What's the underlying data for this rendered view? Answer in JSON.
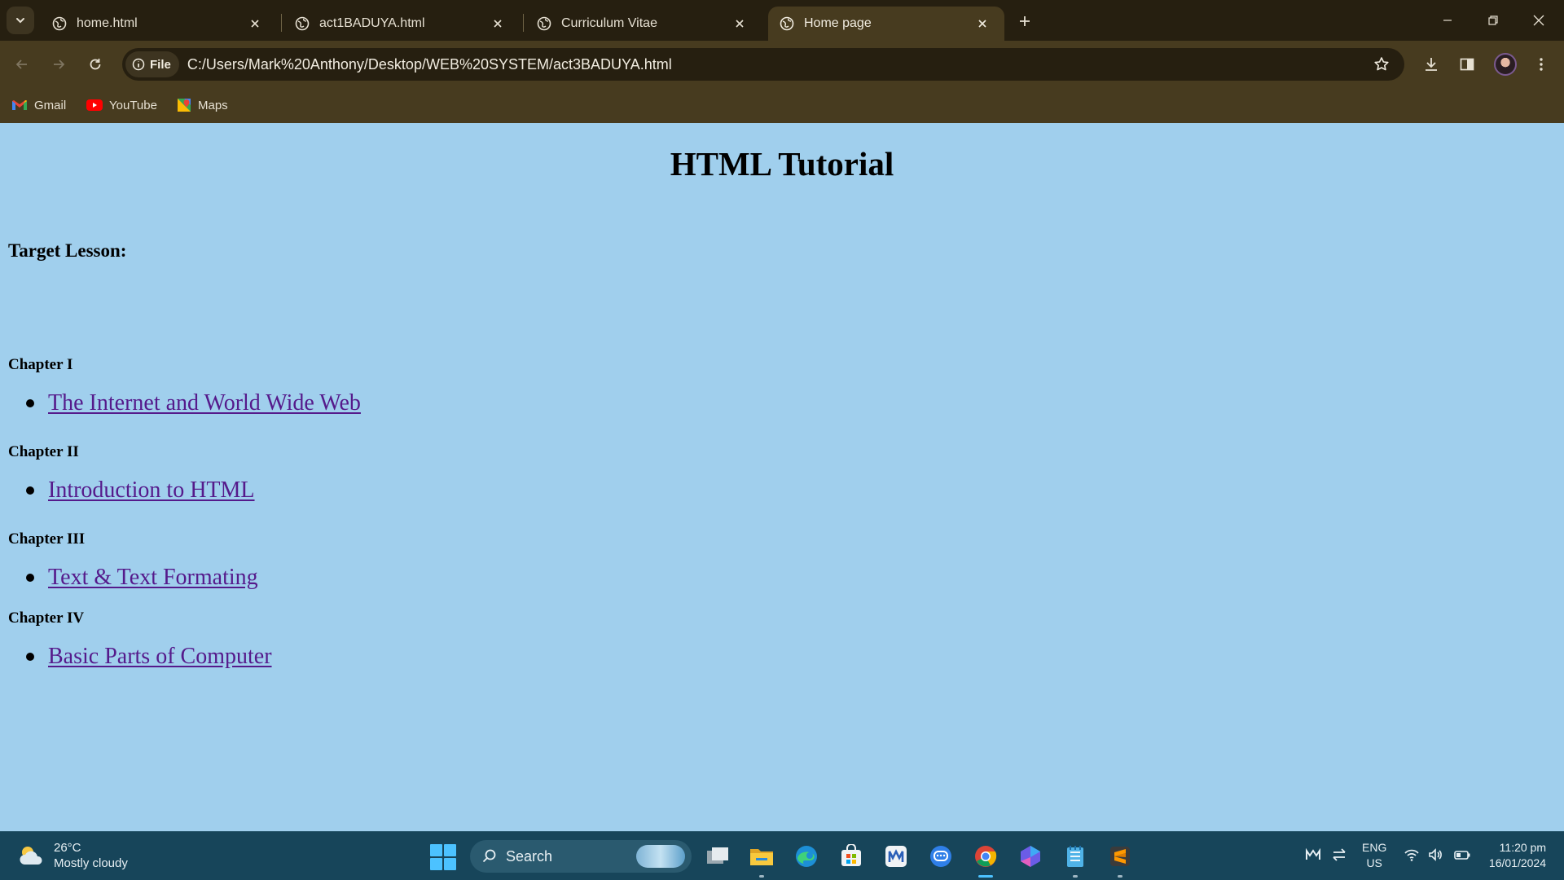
{
  "browser": {
    "tabs": [
      {
        "title": "home.html"
      },
      {
        "title": "act1BADUYA.html"
      },
      {
        "title": "Curriculum Vitae"
      },
      {
        "title": "Home page"
      }
    ],
    "active_tab": 3,
    "omnibox": {
      "chip_label": "File",
      "url": "C:/Users/Mark%20Anthony/Desktop/WEB%20SYSTEM/act3BADUYA.html"
    },
    "bookmarks": [
      {
        "label": "Gmail",
        "icon": "gmail-icon"
      },
      {
        "label": "YouTube",
        "icon": "youtube-icon"
      },
      {
        "label": "Maps",
        "icon": "maps-icon"
      }
    ]
  },
  "page": {
    "title": "HTML Tutorial",
    "target_label": "Target Lesson:",
    "chapters": [
      {
        "heading": "Chapter I",
        "lesson": "The Internet and World Wide Web"
      },
      {
        "heading": "Chapter II",
        "lesson": "Introduction to HTML"
      },
      {
        "heading": "Chapter III",
        "lesson": "Text & Text Formating"
      },
      {
        "heading": "Chapter IV",
        "lesson": "Basic Parts of Computer"
      }
    ],
    "link_color": "#551a8b",
    "background_color": "#a0cfed"
  },
  "taskbar": {
    "weather": {
      "temp": "26°C",
      "condition": "Mostly cloudy"
    },
    "search_placeholder": "Search",
    "language": {
      "lang": "ENG",
      "region": "US"
    },
    "clock": {
      "time": "11:20 pm",
      "date": "16/01/2024"
    },
    "apps": [
      "task-view",
      "file-explorer",
      "edge",
      "microsoft-store",
      "app-m",
      "messaging",
      "chrome",
      "copilot",
      "notepad",
      "sublime-text"
    ]
  },
  "colors": {
    "tab_strip": "#261f10",
    "toolbar": "#473b1f",
    "taskbar": "#17455a",
    "accent": "#4cc2ff"
  }
}
